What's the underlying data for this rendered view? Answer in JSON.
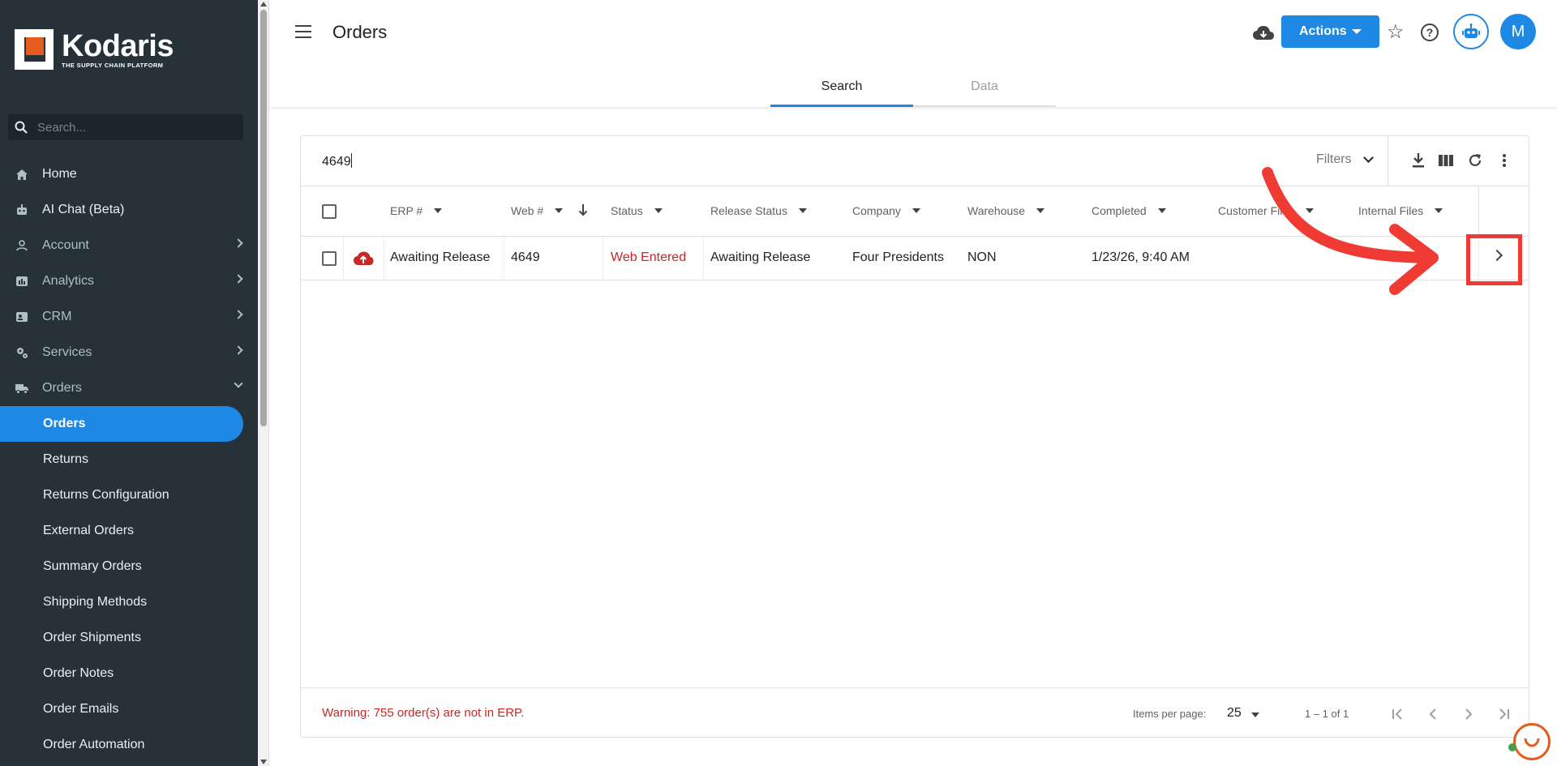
{
  "brand": {
    "name": "Kodaris",
    "tagline": "THE SUPPLY CHAIN PLATFORM",
    "accent_color": "#1e88e5",
    "logo_color": "#e65c1f"
  },
  "sidebar": {
    "search_placeholder": "Search...",
    "items": [
      {
        "label": "Home",
        "icon": "home-icon",
        "has_chevron": false
      },
      {
        "label": "AI Chat (Beta)",
        "icon": "robot-icon",
        "has_chevron": false
      },
      {
        "label": "Account",
        "icon": "person-icon",
        "has_chevron": true
      },
      {
        "label": "Analytics",
        "icon": "chart-icon",
        "has_chevron": true
      },
      {
        "label": "CRM",
        "icon": "contact-card-icon",
        "has_chevron": true
      },
      {
        "label": "Services",
        "icon": "gears-icon",
        "has_chevron": true
      },
      {
        "label": "Orders",
        "icon": "truck-icon",
        "has_chevron": true,
        "expanded": true
      }
    ],
    "subitems": [
      {
        "label": "Orders",
        "active": true
      },
      {
        "label": "Returns"
      },
      {
        "label": "Returns Configuration"
      },
      {
        "label": "External Orders"
      },
      {
        "label": "Summary Orders"
      },
      {
        "label": "Shipping Methods"
      },
      {
        "label": "Order Shipments"
      },
      {
        "label": "Order Notes"
      },
      {
        "label": "Order Emails"
      },
      {
        "label": "Order Automation"
      }
    ]
  },
  "header": {
    "title": "Orders",
    "actions_label": "Actions",
    "avatar_initial": "M",
    "icons": [
      "cloud-download-icon",
      "star-icon",
      "help-icon",
      "robot-icon"
    ]
  },
  "tabs": [
    {
      "label": "Search",
      "active": true
    },
    {
      "label": "Data",
      "active": false
    }
  ],
  "search": {
    "value": "4649",
    "filters_label": "Filters"
  },
  "table": {
    "columns": [
      "ERP #",
      "Web #",
      "Status",
      "Release Status",
      "Company",
      "Warehouse",
      "Completed",
      "Customer Files",
      "Internal Files"
    ],
    "sorted_column": "Web #",
    "sort_direction": "descending",
    "rows": [
      {
        "erp": "Awaiting Release",
        "web": "4649",
        "status": "Web Entered",
        "release_status": "Awaiting Release",
        "company": "Four Presidents",
        "warehouse": "NON",
        "completed": "1/23/26, 9:40 AM",
        "customer_files": "",
        "internal_files": ""
      }
    ]
  },
  "footer": {
    "warning": "Warning: 755 order(s) are not in ERP.",
    "items_per_page_label": "Items per page:",
    "items_per_page": "25",
    "range": "1 – 1 of 1"
  },
  "annotation": {
    "color": "#ef3b33"
  }
}
